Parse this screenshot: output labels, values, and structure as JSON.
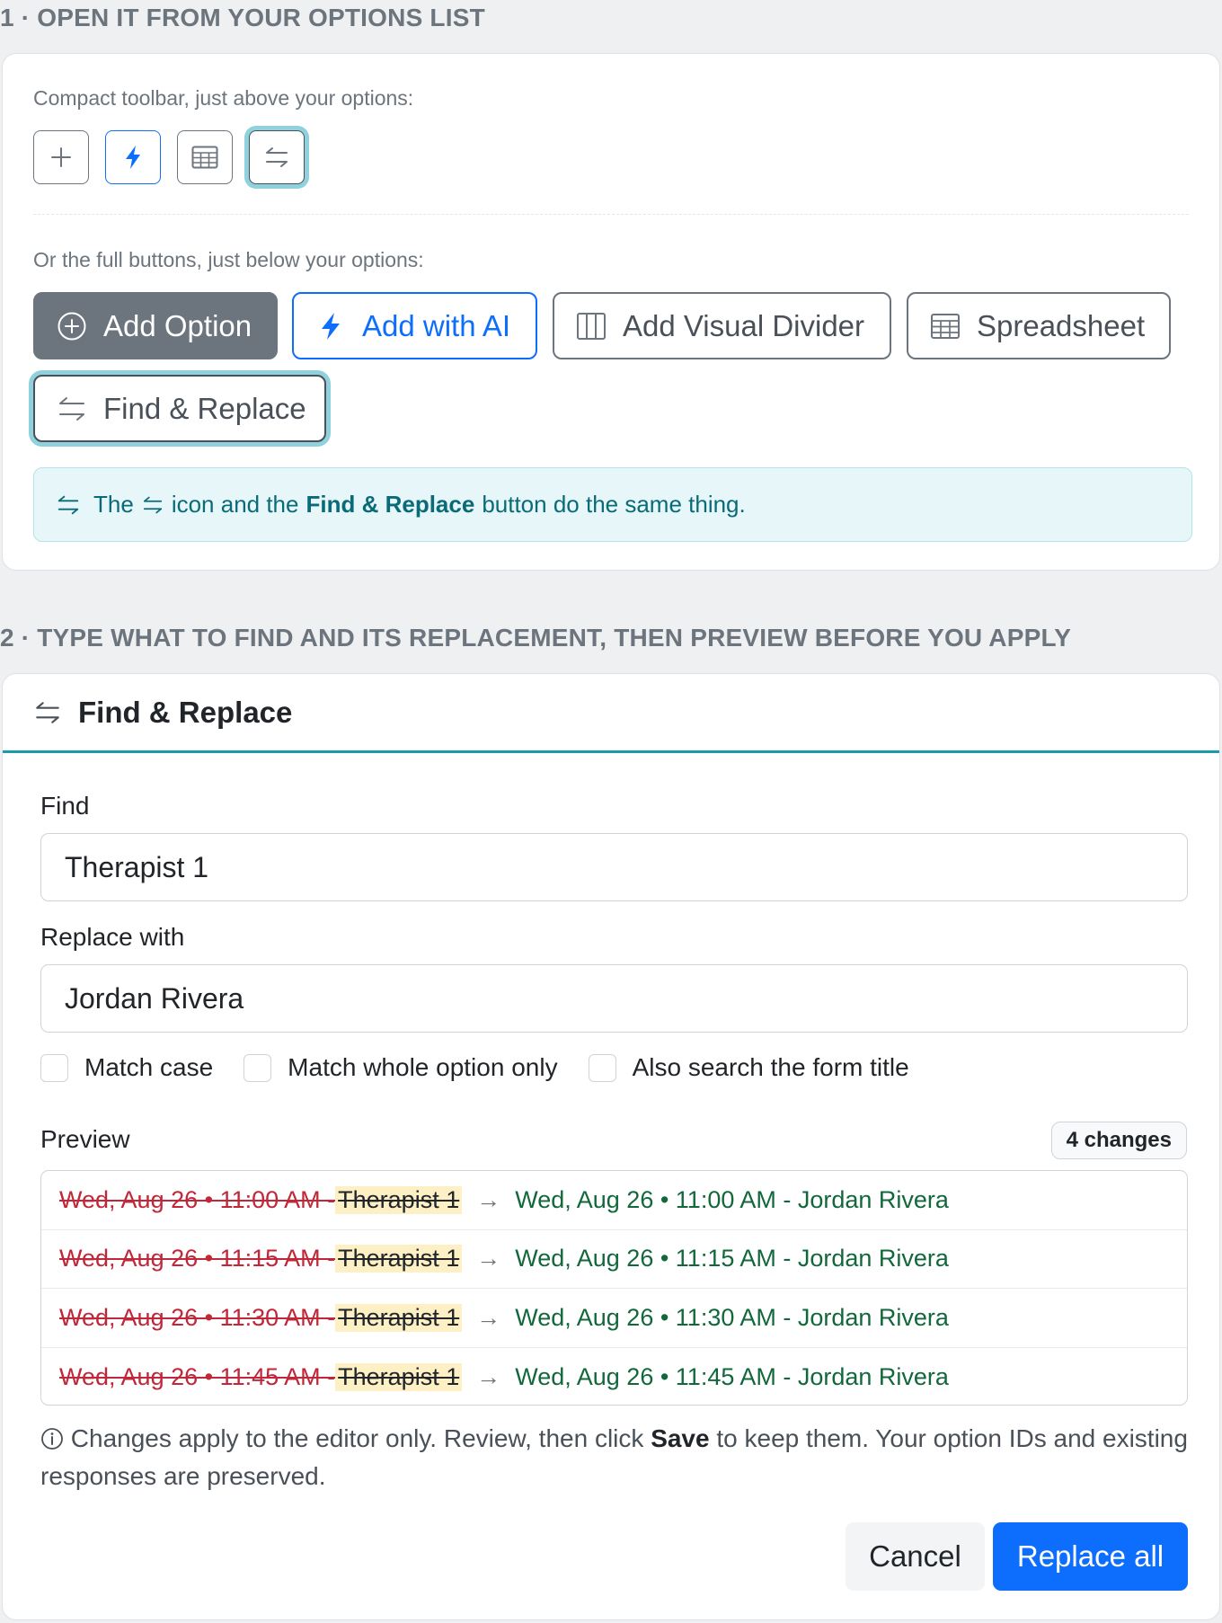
{
  "section1": {
    "heading": "1 · OPEN IT FROM YOUR OPTIONS LIST",
    "compact_label": "Compact toolbar, just above your options:",
    "compact_tools": [
      {
        "icon": "plus-icon"
      },
      {
        "icon": "lightning-icon"
      },
      {
        "icon": "table-icon"
      },
      {
        "icon": "swap-arrows-icon"
      }
    ],
    "full_label": "Or the full buttons, just below your options:",
    "buttons": {
      "add_option": "Add Option",
      "add_ai": "Add with AI",
      "add_divider": "Add Visual Divider",
      "spreadsheet": "Spreadsheet",
      "find_replace": "Find & Replace"
    },
    "callout": {
      "part1": "The",
      "part2": "icon and the",
      "bold": "Find & Replace",
      "part3": "button do the same thing."
    }
  },
  "section2": {
    "heading": "2 · TYPE WHAT TO FIND AND ITS REPLACEMENT, THEN PREVIEW BEFORE YOU APPLY",
    "modal_title": "Find & Replace",
    "find_label": "Find",
    "find_value": "Therapist 1",
    "replace_label": "Replace with",
    "replace_value": "Jordan Rivera",
    "options": {
      "match_case": "Match case",
      "whole_option": "Match whole option only",
      "form_title": "Also search the form title"
    },
    "preview_label": "Preview",
    "changes_badge": "4 changes",
    "rows": [
      {
        "old_prefix": "Wed, Aug 26 • 11:00 AM - ",
        "old_match": "Therapist 1",
        "new": "Wed, Aug 26 • 11:00 AM - Jordan Rivera"
      },
      {
        "old_prefix": "Wed, Aug 26 • 11:15 AM - ",
        "old_match": "Therapist 1",
        "new": "Wed, Aug 26 • 11:15 AM - Jordan Rivera"
      },
      {
        "old_prefix": "Wed, Aug 26 • 11:30 AM - ",
        "old_match": "Therapist 1",
        "new": "Wed, Aug 26 • 11:30 AM - Jordan Rivera"
      },
      {
        "old_prefix": "Wed, Aug 26 • 11:45 AM - ",
        "old_match": "Therapist 1",
        "new": "Wed, Aug 26 • 11:45 AM - Jordan Rivera"
      }
    ],
    "footnote": {
      "part1": "Changes apply to the editor only. Review, then click",
      "bold": "Save",
      "part2": "to keep them. Your option IDs and existing responses are preserved."
    },
    "cancel_label": "Cancel",
    "replace_all_label": "Replace all"
  },
  "colors": {
    "primary": "#0d6efd",
    "teal_accent": "#1a9aaa",
    "removed_text": "#c0283a",
    "added_text": "#12683b",
    "match_highlight": "#fdf0c4"
  }
}
